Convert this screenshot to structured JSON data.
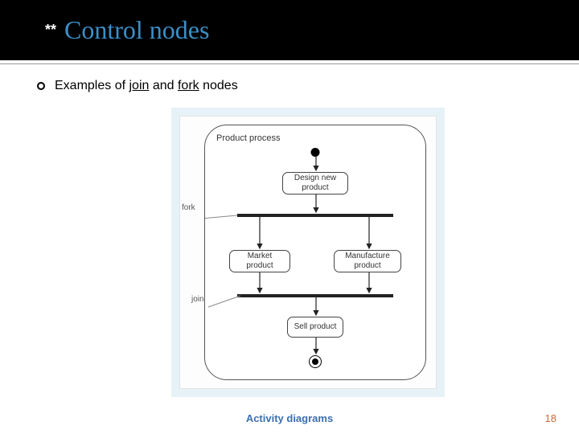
{
  "header": {
    "prefix": "**",
    "title": "Control nodes"
  },
  "bullet": {
    "pre": "Examples of ",
    "word1": "join",
    "mid": " and ",
    "word2": "fork",
    "post": " nodes"
  },
  "diagram": {
    "frame_title": "Product process",
    "activities": {
      "design": "Design new product",
      "market": "Market product",
      "manufacture": "Manufacture product",
      "sell": "Sell product"
    },
    "notes": {
      "fork": "fork",
      "join": "join"
    }
  },
  "footer": {
    "caption": "Activity diagrams",
    "page": "18"
  }
}
